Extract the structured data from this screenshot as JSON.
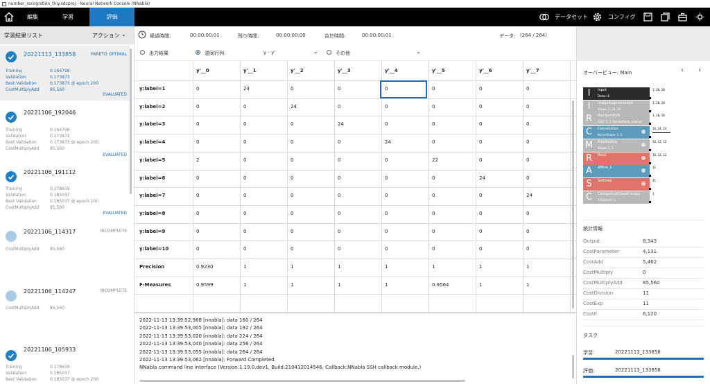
{
  "window": {
    "title": "number_recognition_tiny.sdcproj - Neural Network Console (NNabla)"
  },
  "nav": {
    "tabs": [
      {
        "label": "編集",
        "active": false
      },
      {
        "label": "学習",
        "active": false
      },
      {
        "label": "評価",
        "active": true
      }
    ],
    "dataset_label": "データセット",
    "config_label": "コンフィグ",
    "accent_color": "#1e78c2"
  },
  "left": {
    "title": "学習結果リスト",
    "action_label": "アクション",
    "results": [
      {
        "name": "20221113_133858",
        "state": "PARETO OPTIMAL",
        "state2": "EVALUATED",
        "selected": true,
        "status": "check",
        "metrics": [
          {
            "k": "Training",
            "v": "0.164798"
          },
          {
            "k": "Validation",
            "v": "0.173873"
          },
          {
            "k": "Best Validation",
            "v": "0.173873 @ epoch 200"
          },
          {
            "k": "CostMultiplyAdd",
            "v": "85,560"
          }
        ]
      },
      {
        "name": "20221106_192046",
        "state": "",
        "state2": "EVALUATED",
        "selected": false,
        "status": "check",
        "metrics": [
          {
            "k": "Training",
            "v": "0.164798"
          },
          {
            "k": "Validation",
            "v": "0.173873"
          },
          {
            "k": "Best Validation",
            "v": "0.173873 @ epoch 200"
          },
          {
            "k": "CostMultiplyAdd",
            "v": "85,560"
          }
        ]
      },
      {
        "name": "20221106_191112",
        "state": "",
        "state2": "EVALUATED",
        "selected": false,
        "status": "check",
        "metrics": [
          {
            "k": "Training",
            "v": "0.178659"
          },
          {
            "k": "Validation",
            "v": "0.185037"
          },
          {
            "k": "Best Validation",
            "v": "0.185037 @ epoch 200"
          },
          {
            "k": "CostMultiplyAdd",
            "v": "85,560"
          }
        ]
      },
      {
        "name": "20221106_114317",
        "state": "INCOMPLETE",
        "state2": "",
        "selected": false,
        "status": "incomplete",
        "metrics": [
          {
            "k": "CostMultiplyAdd",
            "v": "85,560"
          }
        ]
      },
      {
        "name": "20221106_114247",
        "state": "INCOMPLETE",
        "state2": "",
        "selected": false,
        "status": "incomplete",
        "metrics": [
          {
            "k": "CostMultiplyAdd",
            "v": "85,560"
          }
        ]
      },
      {
        "name": "20221106_105933",
        "state": "",
        "state2": "",
        "selected": false,
        "status": "check",
        "metrics": [
          {
            "k": "Training",
            "v": "0.178659"
          },
          {
            "k": "Validation",
            "v": "0.185037"
          },
          {
            "k": "Best Validation",
            "v": "0.185037 @ epoch 200"
          }
        ]
      }
    ]
  },
  "timer": {
    "elapsed_label": "経過時間:",
    "elapsed": "00:00:00:01",
    "remaining_label": "残り時間:",
    "remaining": "00:00:00:00",
    "total_label": "合計時間:",
    "total": "00:00:00:01",
    "data_label": "データ:",
    "data": "(264 / 264)"
  },
  "options": {
    "output_label": "出力結果",
    "matrix_label": "混同行列:",
    "matrix_value": "y - y'",
    "other_label": "その他"
  },
  "matrix": {
    "columns": [
      "y'__0",
      "y'__1",
      "y'__2",
      "y'__3",
      "y'__4",
      "y'__5",
      "y'__6",
      "y'__7"
    ],
    "rows": [
      {
        "label": "y:label=1",
        "cells": [
          "0",
          "24",
          "0",
          "0",
          "0",
          "0",
          "0",
          "0"
        ]
      },
      {
        "label": "y:label=2",
        "cells": [
          "0",
          "0",
          "24",
          "0",
          "0",
          "0",
          "0",
          "0"
        ]
      },
      {
        "label": "y:label=3",
        "cells": [
          "0",
          "0",
          "0",
          "24",
          "0",
          "0",
          "0",
          "0"
        ]
      },
      {
        "label": "y:label=4",
        "cells": [
          "0",
          "0",
          "0",
          "0",
          "24",
          "0",
          "0",
          "0"
        ]
      },
      {
        "label": "y:label=5",
        "cells": [
          "2",
          "0",
          "0",
          "0",
          "0",
          "22",
          "0",
          "0"
        ]
      },
      {
        "label": "y:label=6",
        "cells": [
          "0",
          "0",
          "0",
          "0",
          "0",
          "0",
          "24",
          "0"
        ]
      },
      {
        "label": "y:label=7",
        "cells": [
          "0",
          "0",
          "0",
          "0",
          "0",
          "0",
          "0",
          "24"
        ]
      },
      {
        "label": "y:label=8",
        "cells": [
          "0",
          "0",
          "0",
          "0",
          "0",
          "0",
          "0",
          "0"
        ]
      },
      {
        "label": "y:label=9",
        "cells": [
          "0",
          "0",
          "0",
          "0",
          "0",
          "0",
          "0",
          "0"
        ]
      },
      {
        "label": "y:label=10",
        "cells": [
          "0",
          "0",
          "0",
          "0",
          "0",
          "0",
          "0",
          "0"
        ]
      },
      {
        "label": "Precision",
        "cells": [
          "0.9230",
          "1",
          "1",
          "1",
          "1",
          "1",
          "1",
          "1"
        ]
      },
      {
        "label": "F-Measures",
        "cells": [
          "0.9599",
          "1",
          "1",
          "1",
          "1",
          "0.9564",
          "1",
          "1"
        ]
      },
      {
        "label": "",
        "cells": [
          "",
          "",
          "",
          "",
          "",
          "",
          "",
          ""
        ]
      }
    ]
  },
  "log": {
    "lines": [
      "2022-11-13 13:39:52,988 [nnabla]: data 160 / 264",
      "2022-11-13 13:39:53,005 [nnabla]: data 192 / 264",
      "2022-11-13 13:39:53,020 [nnabla]: data 224 / 264",
      "2022-11-13 13:39:53,040 [nnabla]: data 256 / 264",
      "2022-11-13 13:39:53,055 [nnabla]: data 264 / 264",
      "2022-11-13 13:39:53,062 [nnabla]: Forward Completed.",
      "NNabla command line interface (Version:1.19.0.dev1, Build:210412014546, Callback:NNabla SSH callback module.)"
    ]
  },
  "right": {
    "overview_label": "オーバービュー: Main",
    "layers": [
      {
        "letter": "I",
        "name": "Input",
        "sub": "Datas: 4",
        "color": "#2a2a2a",
        "shape": "1, 28, 28"
      },
      {
        "letter": "I",
        "name": "ImageAugmentation",
        "sub": "Shape: 1, 28, 28",
        "color": "#b8b8b8",
        "shape": "1, 28, 28"
      },
      {
        "letter": "R",
        "name": "RandomShift",
        "sub": "Shift: 2, 2, BorderMode: nearest",
        "color": "#b8b8b8",
        "shape": "1, 28, 28"
      },
      {
        "letter": "C",
        "name": "Convolution",
        "sub": "KernelShape: 5, 5",
        "color": "#5d9bbd",
        "shape": "16, 24, 24"
      },
      {
        "letter": "M",
        "name": "MaxPooling",
        "sub": "Shape: 2, 2",
        "color": "#b8b8b8",
        "shape": "16, 12, 12"
      },
      {
        "letter": "R",
        "name": "ReLU",
        "sub": "",
        "color": "#e0746a",
        "shape": "16, 12, 12"
      },
      {
        "letter": "A",
        "name": "Affine_2",
        "sub": "",
        "color": "#5d9bbd",
        "shape": "11"
      },
      {
        "letter": "S",
        "name": "Softmax",
        "sub": "",
        "color": "#e0746a",
        "shape": "11"
      },
      {
        "letter": "C",
        "name": "CategoricalCrossEntropy",
        "sub": "T.Datasets: y",
        "color": "#b8b8b8",
        "shape": "1"
      }
    ],
    "stats_title": "統計情報",
    "stats": [
      {
        "k": "Output",
        "v": "8,343"
      },
      {
        "k": "CostParameter",
        "v": "4,131"
      },
      {
        "k": "CostAdd",
        "v": "5,462"
      },
      {
        "k": "CostMultiply",
        "v": "0"
      },
      {
        "k": "CostMultiplyAdd",
        "v": "85,560"
      },
      {
        "k": "CostDivision",
        "v": "11"
      },
      {
        "k": "CostExp",
        "v": "11"
      },
      {
        "k": "CostIf",
        "v": "6,120"
      }
    ],
    "task_title": "タスク",
    "tasks": [
      {
        "label": "学習:",
        "name": "20221113_133858",
        "progress": 1.0
      },
      {
        "label": "評価:",
        "name": "20221113_133858",
        "progress": 1.0
      }
    ]
  }
}
